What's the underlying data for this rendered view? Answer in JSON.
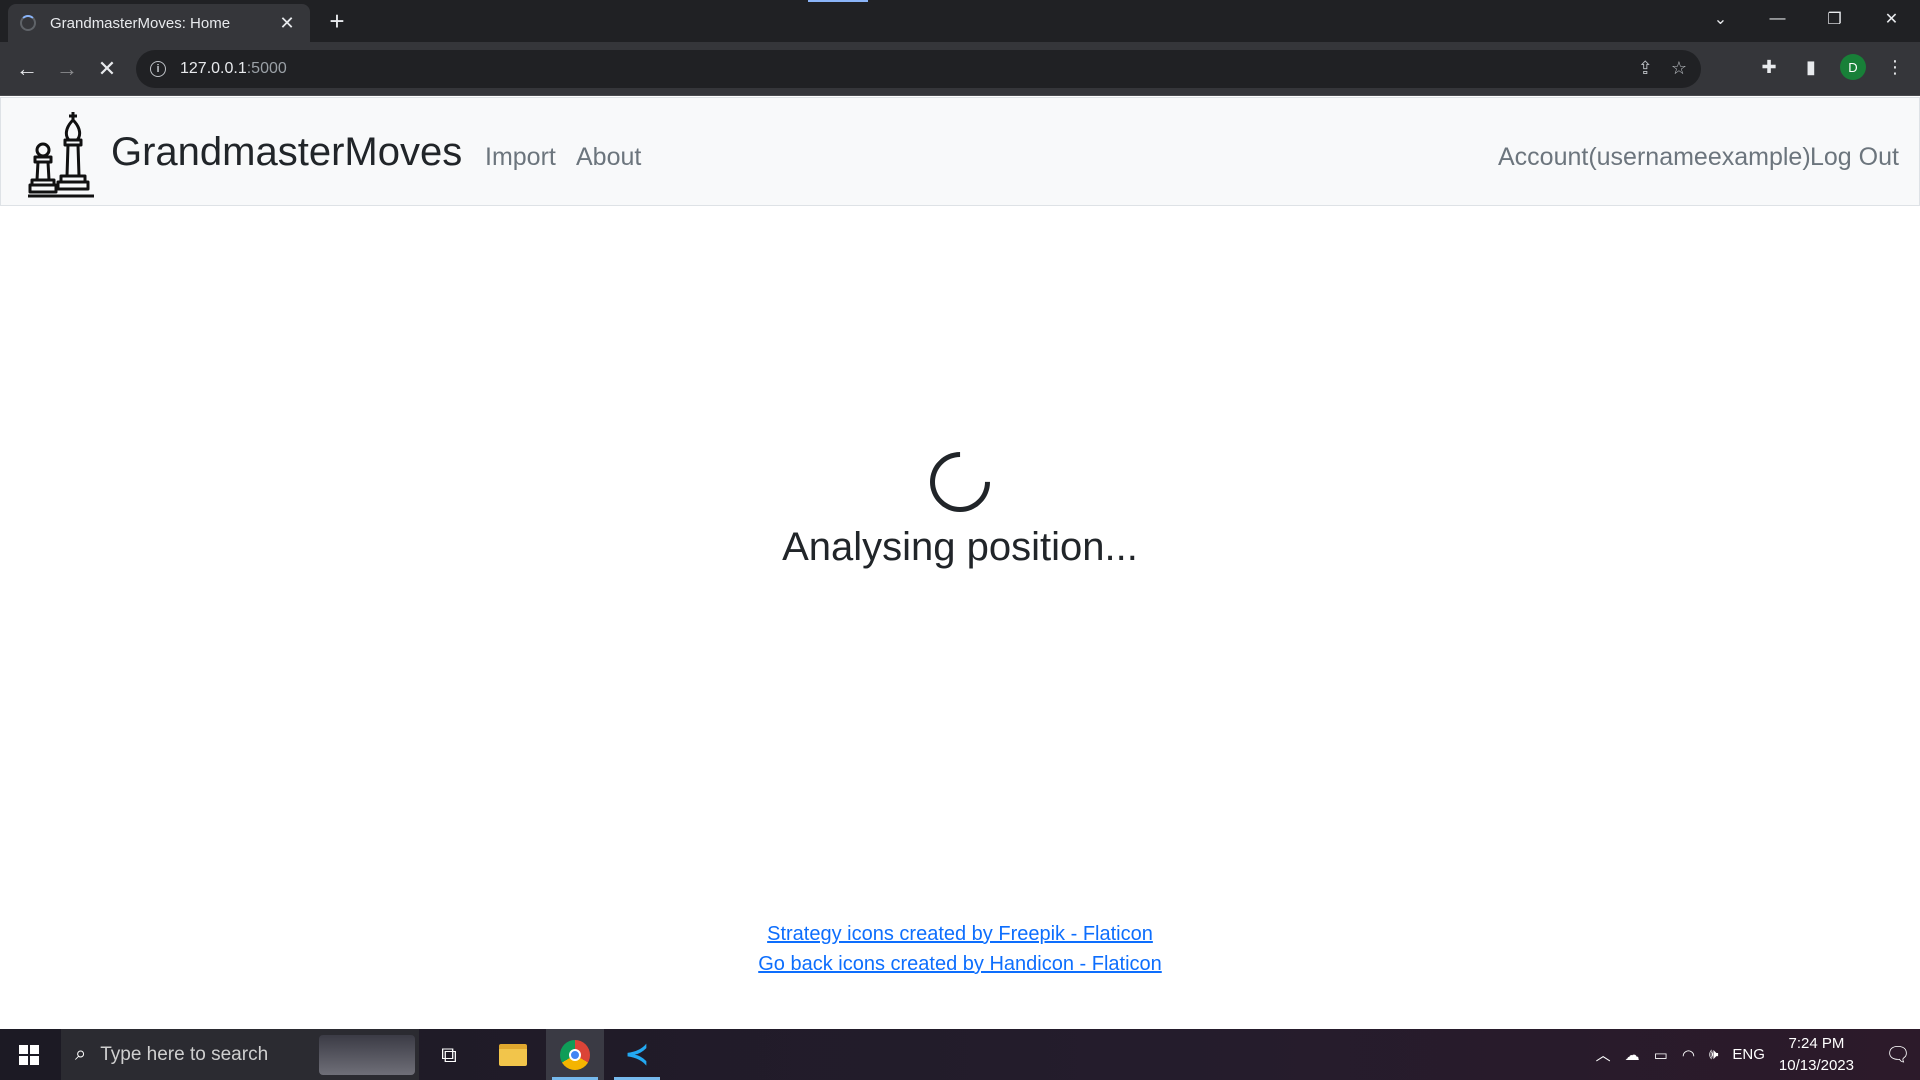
{
  "browser": {
    "tab_title": "GrandmasterMoves: Home",
    "url_host": "127.0.0.1",
    "url_port": ":5000",
    "profile_initial": "D"
  },
  "navbar": {
    "brand": "GrandmasterMoves",
    "links": [
      "Import",
      "About"
    ],
    "account": "Account(usernameexample)",
    "logout": "Log Out"
  },
  "main": {
    "status_text": "Analysing position..."
  },
  "footer": {
    "credits": [
      "Strategy icons created by Freepik - Flaticon",
      "Go back icons created by Handicon - Flaticon"
    ]
  },
  "taskbar": {
    "search_placeholder": "Type here to search",
    "language": "ENG",
    "time": "7:24 PM",
    "date": "10/13/2023"
  }
}
